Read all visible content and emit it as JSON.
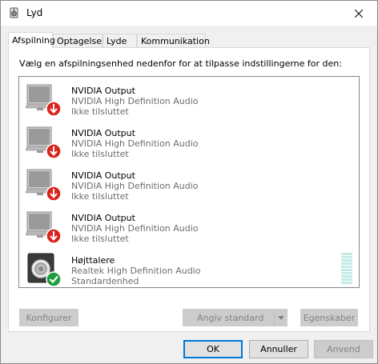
{
  "window": {
    "title": "Lyd",
    "close_icon": "close-icon",
    "app_icon": "speaker-icon"
  },
  "tabs": [
    {
      "label": "Afspilning",
      "active": true
    },
    {
      "label": "Optagelse",
      "active": false
    },
    {
      "label": "Lyde",
      "active": false
    },
    {
      "label": "Kommunikation",
      "active": false
    }
  ],
  "panel": {
    "instruction": "Vælg en afspilningsenhed nedenfor for at tilpasse indstillingerne for den:"
  },
  "devices": [
    {
      "name": "NVIDIA Output",
      "driver": "NVIDIA High Definition Audio",
      "status": "Ikke tilsluttet",
      "icon": "monitor-icon",
      "badge": "disconnected-down-arrow-icon"
    },
    {
      "name": "NVIDIA Output",
      "driver": "NVIDIA High Definition Audio",
      "status": "Ikke tilsluttet",
      "icon": "monitor-icon",
      "badge": "disconnected-down-arrow-icon"
    },
    {
      "name": "NVIDIA Output",
      "driver": "NVIDIA High Definition Audio",
      "status": "Ikke tilsluttet",
      "icon": "monitor-icon",
      "badge": "disconnected-down-arrow-icon"
    },
    {
      "name": "NVIDIA Output",
      "driver": "NVIDIA High Definition Audio",
      "status": "Ikke tilsluttet",
      "icon": "monitor-icon",
      "badge": "disconnected-down-arrow-icon"
    },
    {
      "name": "Højttalere",
      "driver": "Realtek High Definition Audio",
      "status": "Standardenhed",
      "icon": "speaker-icon",
      "badge": "default-check-icon",
      "level": 0
    }
  ],
  "panel_buttons": {
    "configure": "Konfigurer",
    "set_default": "Angiv standard",
    "properties": "Egenskaber"
  },
  "dialog_buttons": {
    "ok": "OK",
    "cancel": "Annuller",
    "apply": "Anvend"
  },
  "colors": {
    "accent": "#0078d7",
    "badge_red": "#d9251d",
    "badge_green": "#1e9e3a",
    "meter": "#c5ebe6"
  }
}
